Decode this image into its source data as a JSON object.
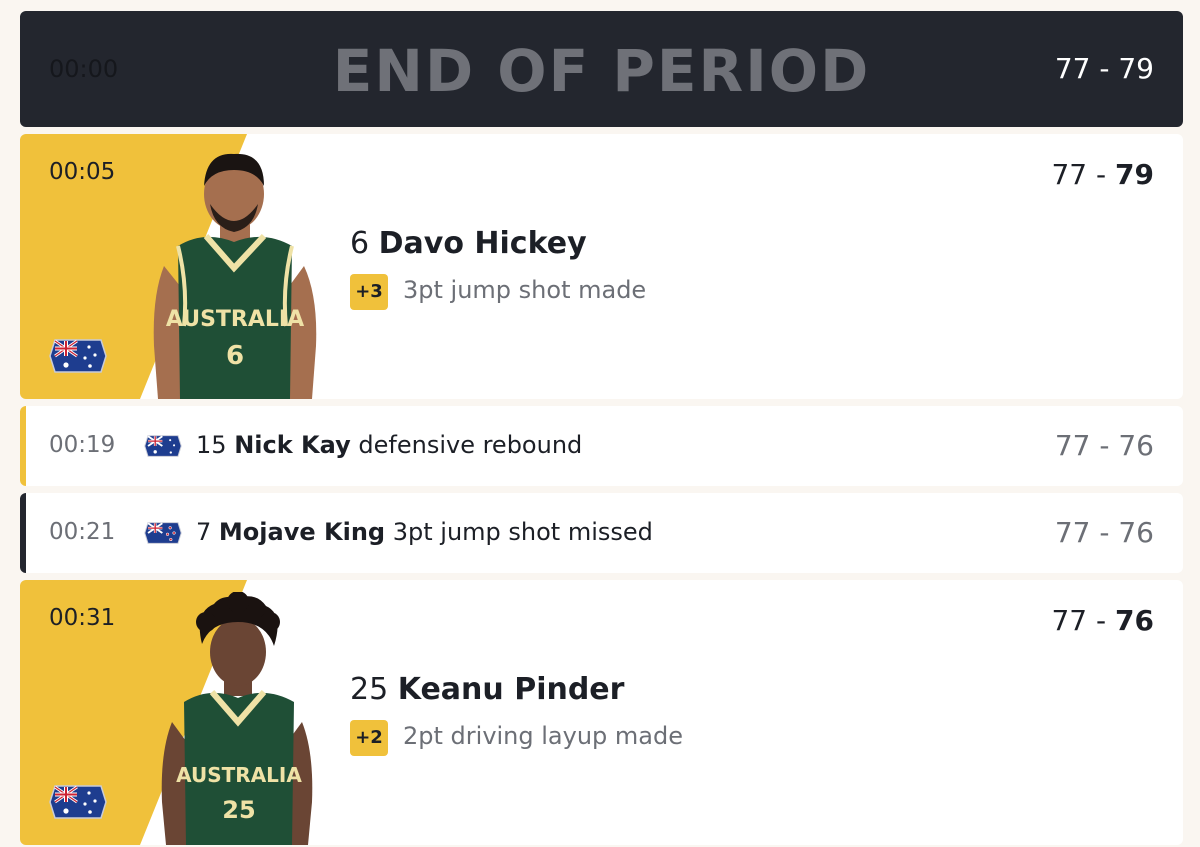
{
  "period": {
    "time": "00:00",
    "title": "END OF PERIOD",
    "score": "77 - 79"
  },
  "colors": {
    "accent_yellow": "#f0c13b",
    "dark": "#23262e",
    "muted": "#6c6f76"
  },
  "events": [
    {
      "kind": "card",
      "time": "00:05",
      "score_home": "77",
      "score_sep": " - ",
      "score_away": "79",
      "number": "6",
      "player": "Davo Hickey",
      "points": "+3",
      "description": "3pt jump shot made",
      "team_flag": "australia-flag-icon",
      "jersey_number": "6",
      "jersey_text": "AUSTRALIA"
    },
    {
      "kind": "row",
      "time": "00:19",
      "number": "15",
      "player": "Nick Kay",
      "description": "defensive rebound",
      "score": "77 - 76",
      "bar_color": "#f0c13b"
    },
    {
      "kind": "row",
      "time": "00:21",
      "number": "7",
      "player": "Mojave King",
      "description": "3pt jump shot missed",
      "score": "77 - 76",
      "bar_color": "#23262e"
    },
    {
      "kind": "card",
      "time": "00:31",
      "score_home": "77",
      "score_sep": " - ",
      "score_away": "76",
      "number": "25",
      "player": "Keanu Pinder",
      "points": "+2",
      "description": "2pt driving layup made",
      "team_flag": "australia-flag-icon",
      "jersey_number": "25",
      "jersey_text": "AUSTRALIA"
    }
  ]
}
